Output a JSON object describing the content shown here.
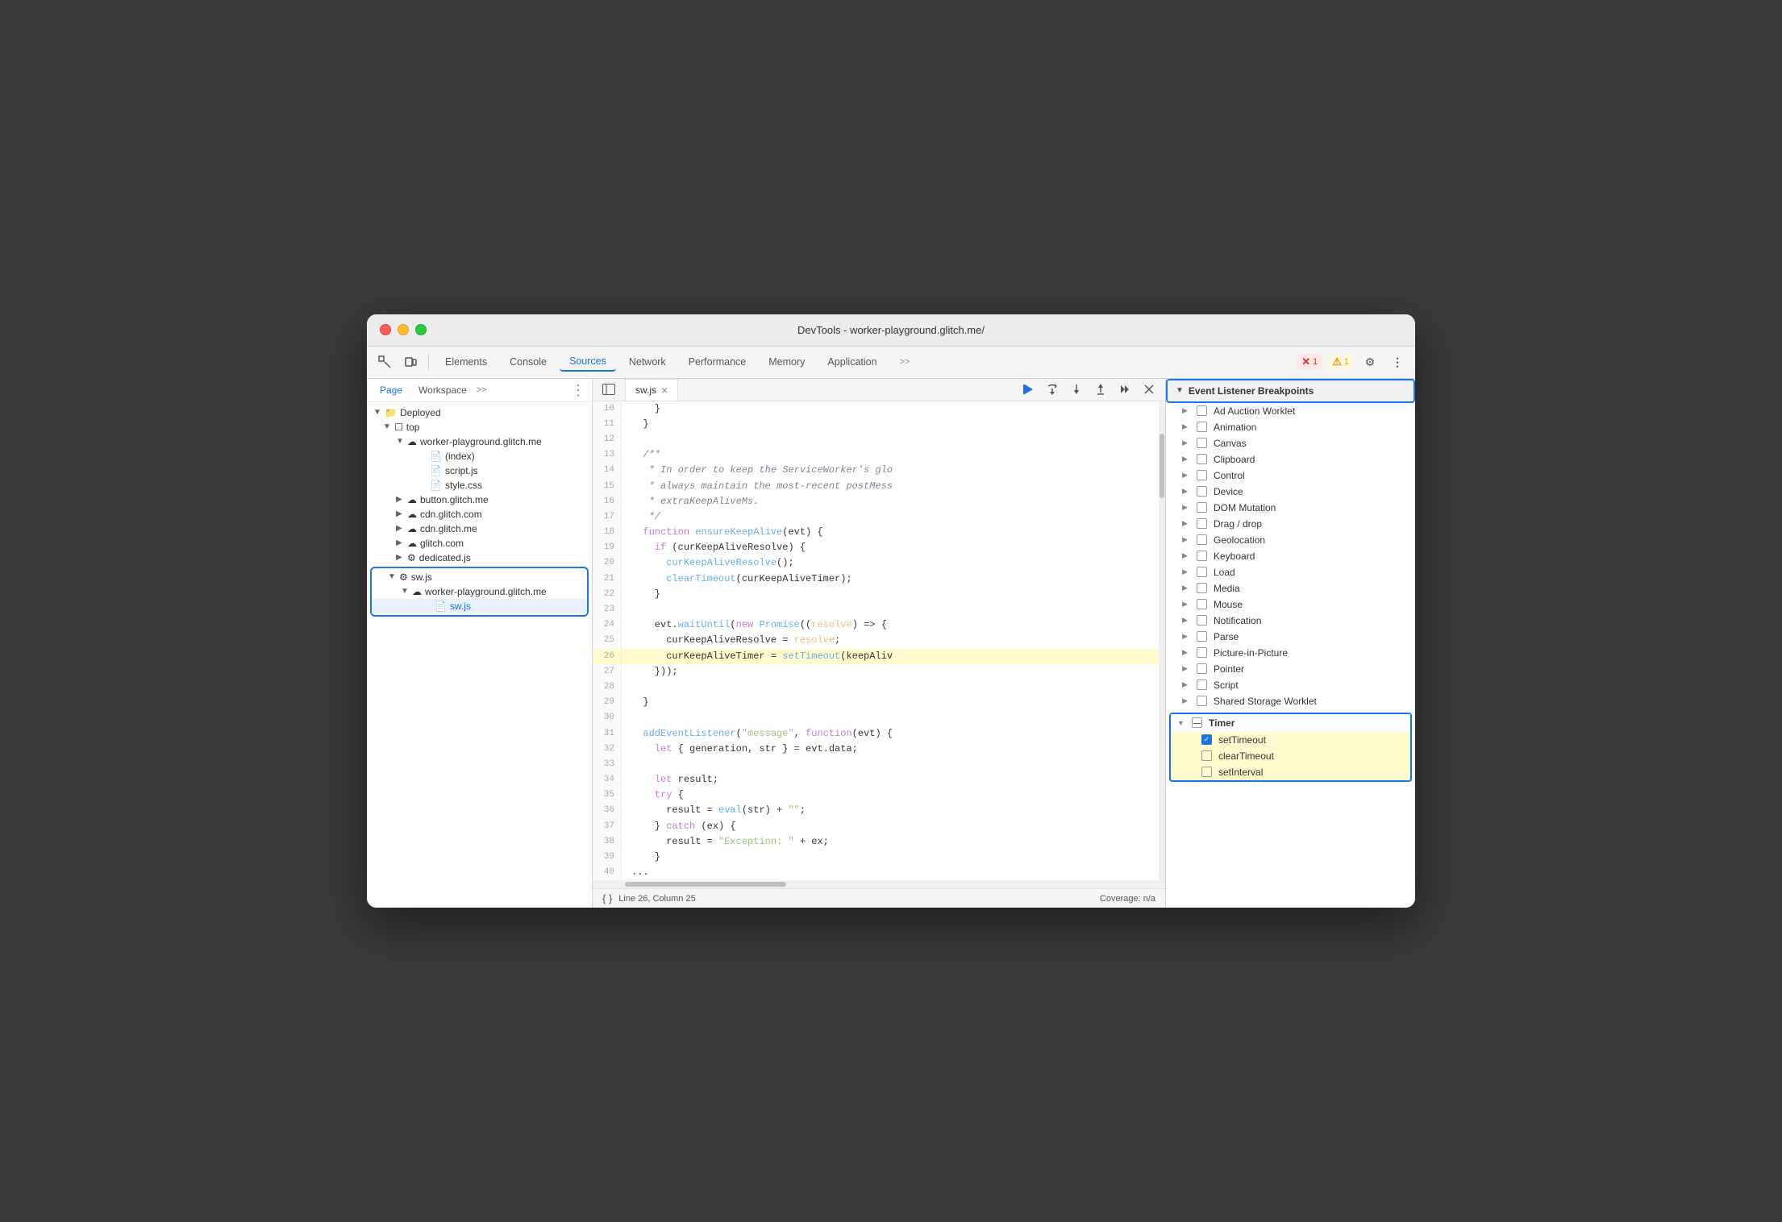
{
  "window": {
    "title": "DevTools - worker-playground.glitch.me/"
  },
  "toolbar": {
    "tabs": [
      {
        "id": "elements",
        "label": "Elements",
        "active": false
      },
      {
        "id": "console",
        "label": "Console",
        "active": false
      },
      {
        "id": "sources",
        "label": "Sources",
        "active": true
      },
      {
        "id": "network",
        "label": "Network",
        "active": false
      },
      {
        "id": "performance",
        "label": "Performance",
        "active": false
      },
      {
        "id": "memory",
        "label": "Memory",
        "active": false
      },
      {
        "id": "application",
        "label": "Application",
        "active": false
      }
    ],
    "error_count": "1",
    "warn_count": "1",
    "more_tools": ">>"
  },
  "file_panel": {
    "tabs": [
      "Page",
      "Workspace"
    ],
    "active_tab": "Page",
    "more": ">>",
    "tree": [
      {
        "id": "deployed",
        "label": "Deployed",
        "indent": 0,
        "type": "folder",
        "expanded": true
      },
      {
        "id": "top",
        "label": "top",
        "indent": 1,
        "type": "folder",
        "expanded": true
      },
      {
        "id": "worker-playground",
        "label": "worker-playground.glitch.me",
        "indent": 2,
        "type": "cloud-folder",
        "expanded": true
      },
      {
        "id": "index",
        "label": "(index)",
        "indent": 3,
        "type": "file"
      },
      {
        "id": "script-js",
        "label": "script.js",
        "indent": 3,
        "type": "file-js"
      },
      {
        "id": "style-css",
        "label": "style.css",
        "indent": 3,
        "type": "file-css"
      },
      {
        "id": "button-glitch",
        "label": "button.glitch.me",
        "indent": 2,
        "type": "cloud-folder",
        "expanded": false
      },
      {
        "id": "cdn-glitch-com",
        "label": "cdn.glitch.com",
        "indent": 2,
        "type": "cloud-folder",
        "expanded": false
      },
      {
        "id": "cdn-glitch-me",
        "label": "cdn.glitch.me",
        "indent": 2,
        "type": "cloud-folder",
        "expanded": false
      },
      {
        "id": "glitch-com",
        "label": "glitch.com",
        "indent": 2,
        "type": "cloud-folder",
        "expanded": false
      },
      {
        "id": "dedicated-js",
        "label": "dedicated.js",
        "indent": 2,
        "type": "file-gear"
      }
    ],
    "selected_group": {
      "root": {
        "label": "sw.js",
        "type": "file-gear"
      },
      "child_cloud": {
        "label": "worker-playground.glitch.me",
        "type": "cloud-folder"
      },
      "child_file": {
        "label": "sw.js",
        "type": "file-js"
      }
    }
  },
  "code_panel": {
    "active_file": "sw.js",
    "lines": [
      {
        "num": 10,
        "content": "    }"
      },
      {
        "num": 11,
        "content": "  }"
      },
      {
        "num": 12,
        "content": ""
      },
      {
        "num": 13,
        "content": "  /**",
        "type": "comment"
      },
      {
        "num": 14,
        "content": "   * In order to keep the ServiceWorker's glo",
        "type": "comment"
      },
      {
        "num": 15,
        "content": "   * always maintain the most-recent postMess",
        "type": "comment"
      },
      {
        "num": 16,
        "content": "   * extraKeepAliveMs.",
        "type": "comment"
      },
      {
        "num": 17,
        "content": "   */",
        "type": "comment"
      },
      {
        "num": 18,
        "content": "  function ensureKeepAlive(evt) {",
        "type": "fn"
      },
      {
        "num": 19,
        "content": "    if (curKeepAliveResolve) {",
        "type": "keyword"
      },
      {
        "num": 20,
        "content": "      curKeepAliveResolve();",
        "type": "fn"
      },
      {
        "num": 21,
        "content": "      clearTimeout(curKeepAliveTimer);",
        "type": "fn"
      },
      {
        "num": 22,
        "content": "    }"
      },
      {
        "num": 23,
        "content": ""
      },
      {
        "num": 24,
        "content": "    evt.waitUntil(new Promise((resolve) => {",
        "type": "fn"
      },
      {
        "num": 25,
        "content": "      curKeepAliveResolve = resolve;"
      },
      {
        "num": 26,
        "content": "      curKeepAliveTimer = setTimeout(keepAliv",
        "type": "highlighted"
      },
      {
        "num": 27,
        "content": "    }));"
      },
      {
        "num": 28,
        "content": ""
      },
      {
        "num": 29,
        "content": "  }"
      },
      {
        "num": 30,
        "content": ""
      },
      {
        "num": 31,
        "content": "  addEventListener(\"message\", function(evt) {",
        "type": "fn"
      },
      {
        "num": 32,
        "content": "    let { generation, str } = evt.data;"
      },
      {
        "num": 33,
        "content": ""
      },
      {
        "num": 34,
        "content": "    let result;"
      },
      {
        "num": 35,
        "content": "    try {"
      },
      {
        "num": 36,
        "content": "      result = eval(str) + \"\";",
        "type": "fn"
      },
      {
        "num": 37,
        "content": "    } catch (ex) {"
      },
      {
        "num": 38,
        "content": "      result = \"Exception: \" + ex;",
        "type": "str"
      },
      {
        "num": 39,
        "content": "    }"
      },
      {
        "num": 40,
        "content": "..."
      }
    ],
    "footer": {
      "format_btn": "{ }",
      "position": "Line 26, Column 25",
      "coverage": "Coverage: n/a"
    },
    "controls": {
      "pause": "▶",
      "step_over": "↻",
      "step_into": "↓",
      "step_out": "↑",
      "continue": "→→",
      "deactivate": "⊘"
    }
  },
  "right_panel": {
    "section_title": "Event Listener Breakpoints",
    "items": [
      {
        "label": "Ad Auction Worklet",
        "checked": false,
        "has_children": true
      },
      {
        "label": "Animation",
        "checked": false,
        "has_children": true
      },
      {
        "label": "Canvas",
        "checked": false,
        "has_children": true
      },
      {
        "label": "Clipboard",
        "checked": false,
        "has_children": true
      },
      {
        "label": "Control",
        "checked": false,
        "has_children": true
      },
      {
        "label": "Device",
        "checked": false,
        "has_children": true
      },
      {
        "label": "DOM Mutation",
        "checked": false,
        "has_children": true
      },
      {
        "label": "Drag / drop",
        "checked": false,
        "has_children": true
      },
      {
        "label": "Geolocation",
        "checked": false,
        "has_children": true
      },
      {
        "label": "Keyboard",
        "checked": false,
        "has_children": true
      },
      {
        "label": "Load",
        "checked": false,
        "has_children": true
      },
      {
        "label": "Media",
        "checked": false,
        "has_children": true
      },
      {
        "label": "Mouse",
        "checked": false,
        "has_children": true
      },
      {
        "label": "Notification",
        "checked": false,
        "has_children": true
      },
      {
        "label": "Parse",
        "checked": false,
        "has_children": true
      },
      {
        "label": "Picture-in-Picture",
        "checked": false,
        "has_children": true
      },
      {
        "label": "Pointer",
        "checked": false,
        "has_children": true
      },
      {
        "label": "Script",
        "checked": false,
        "has_children": true
      },
      {
        "label": "Shared Storage Worklet",
        "checked": false,
        "has_children": true
      }
    ],
    "timer_section": {
      "label": "Timer",
      "expanded": true,
      "children": [
        {
          "label": "setTimeout",
          "checked": true
        },
        {
          "label": "clearTimeout",
          "checked": false
        },
        {
          "label": "setInterval",
          "checked": false
        }
      ]
    }
  }
}
